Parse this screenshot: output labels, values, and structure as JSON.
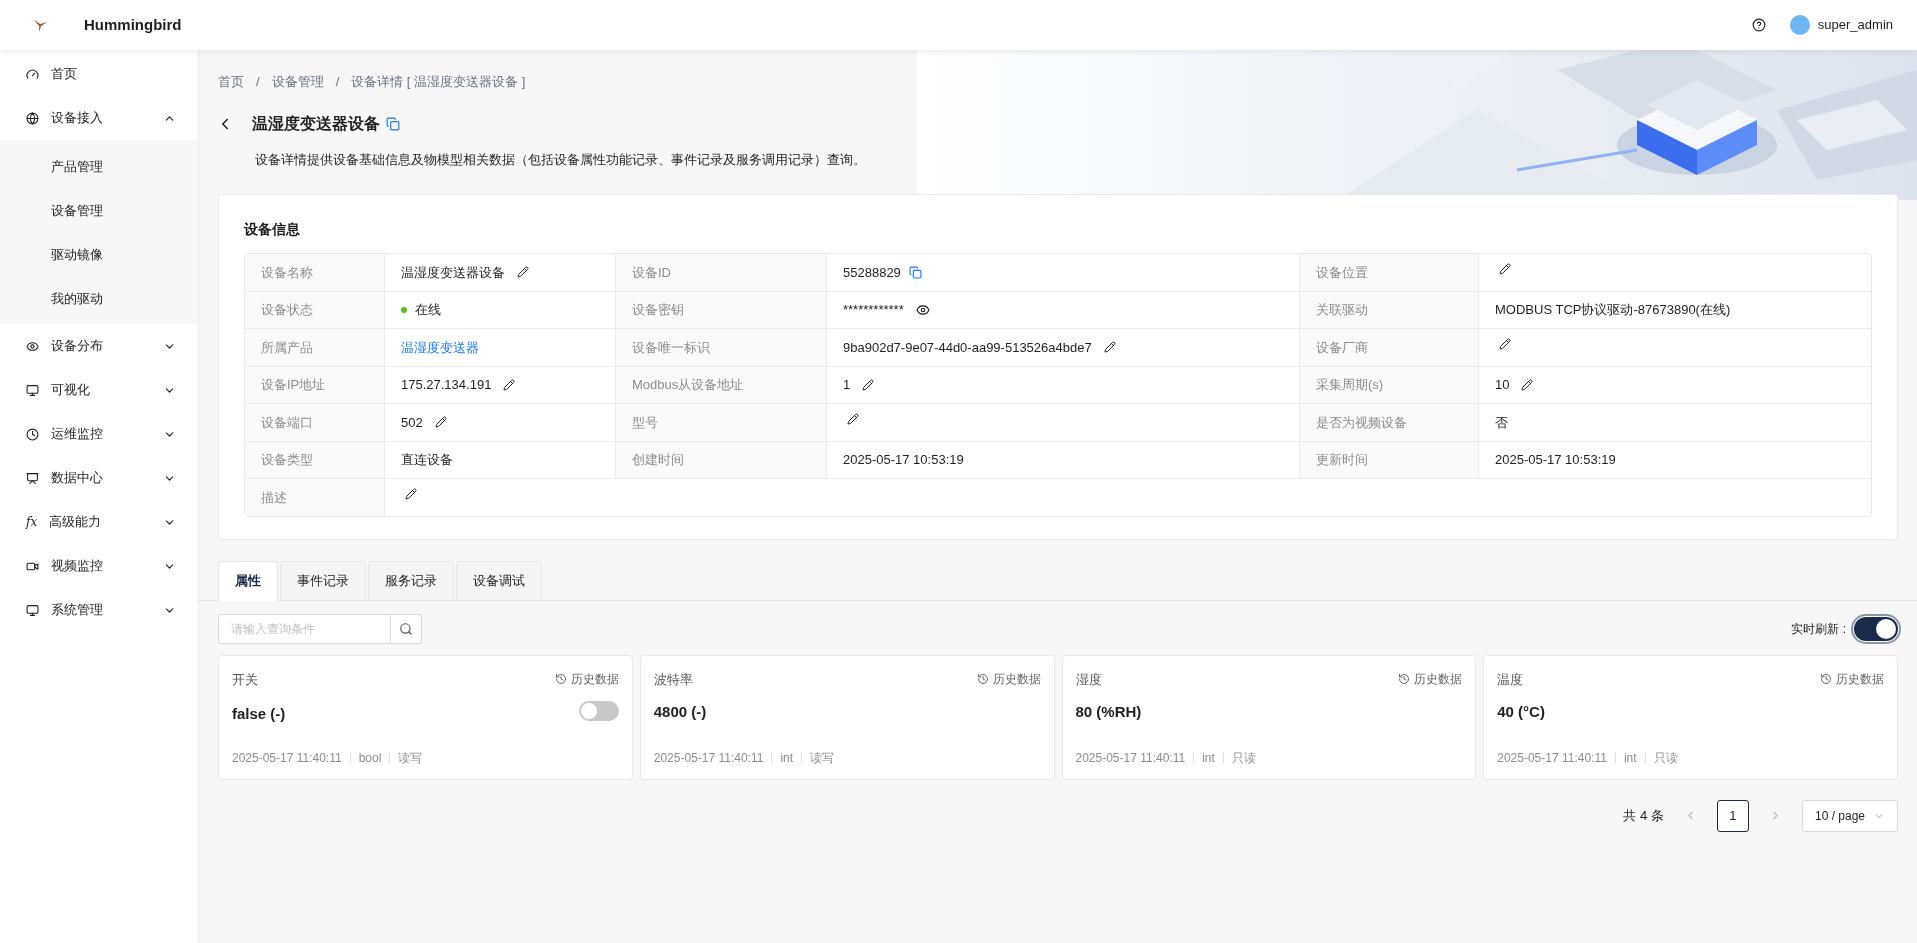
{
  "header": {
    "brand": "Hummingbird",
    "user": "super_admin"
  },
  "sidebar": {
    "items": [
      {
        "label": "首页"
      },
      {
        "label": "设备接入",
        "expanded": true,
        "children": [
          {
            "label": "产品管理"
          },
          {
            "label": "设备管理"
          },
          {
            "label": "驱动镜像"
          },
          {
            "label": "我的驱动"
          }
        ]
      },
      {
        "label": "设备分布",
        "expanded": false
      },
      {
        "label": "可视化",
        "expanded": false
      },
      {
        "label": "运维监控",
        "expanded": false
      },
      {
        "label": "数据中心",
        "expanded": false
      },
      {
        "label": "高级能力",
        "icon_text": "fx",
        "expanded": false
      },
      {
        "label": "视频监控",
        "expanded": false
      },
      {
        "label": "系统管理",
        "expanded": false
      }
    ]
  },
  "breadcrumb": [
    {
      "label": "首页"
    },
    {
      "separator": "/",
      "label": "设备管理"
    },
    {
      "separator": "/",
      "label": "设备详情 [ 温湿度变送器设备 ]"
    }
  ],
  "page": {
    "title": "温湿度变送器设备",
    "description": "设备详情提供设备基础信息及物模型相关数据（包括设备属性功能记录、事件记录及服务调用记录）查询。"
  },
  "device_info": {
    "title": "设备信息",
    "rows": [
      [
        {
          "label": "设备名称",
          "value": "温湿度变送器设备",
          "kind": "text",
          "editable": true
        },
        {
          "label": "设备ID",
          "value": "55288829",
          "kind": "copy",
          "editable": false
        },
        {
          "label": "设备位置",
          "kind": "text",
          "editable": true
        }
      ],
      [
        {
          "label": "设备状态",
          "value": "在线",
          "kind": "status",
          "color": "#52c41a",
          "editable": false
        },
        {
          "label": "设备密钥",
          "value": "************",
          "kind": "secret",
          "editable": false
        },
        {
          "label": "关联驱动",
          "value": "MODBUS TCP协议驱动-87673890(在线)",
          "kind": "text",
          "editable": false
        }
      ],
      [
        {
          "label": "所属产品",
          "value": "温湿度变送器",
          "kind": "link",
          "editable": false
        },
        {
          "label": "设备唯一标识",
          "value": "9ba902d7-9e07-44d0-aa99-513526a4bde7",
          "kind": "text",
          "editable": true
        },
        {
          "label": "设备厂商",
          "kind": "text",
          "editable": true
        }
      ],
      [
        {
          "label": "设备IP地址",
          "value": "175.27.134.191",
          "kind": "text",
          "editable": true
        },
        {
          "label": "Modbus从设备地址",
          "value": "1",
          "kind": "text",
          "editable": true
        },
        {
          "label": "采集周期(s)",
          "value": "10",
          "kind": "text",
          "editable": true
        }
      ],
      [
        {
          "label": "设备端口",
          "value": "502",
          "kind": "text",
          "editable": true
        },
        {
          "label": "型号",
          "kind": "text",
          "editable": true
        },
        {
          "label": "是否为视频设备",
          "value": "否",
          "kind": "text",
          "editable": false
        }
      ],
      [
        {
          "label": "设备类型",
          "value": "直连设备",
          "kind": "text",
          "editable": false
        },
        {
          "label": "创建时间",
          "value": "2025-05-17 10:53:19",
          "kind": "text",
          "editable": false
        },
        {
          "label": "更新时间",
          "value": "2025-05-17 10:53:19",
          "kind": "text",
          "editable": false
        }
      ],
      [
        {
          "label": "描述",
          "kind": "text",
          "editable": true
        }
      ]
    ]
  },
  "tabs": [
    {
      "label": "属性",
      "selected": true
    },
    {
      "label": "事件记录",
      "selected": false
    },
    {
      "label": "服务记录",
      "selected": false
    },
    {
      "label": "设备调试",
      "selected": false
    }
  ],
  "search": {
    "placeholder": "请输入查询条件"
  },
  "realtime_refresh": {
    "label": "实时刷新 :",
    "on": true
  },
  "properties": [
    {
      "name": "开关",
      "history": "历史数据",
      "value": "false (-)",
      "kind": "switch",
      "on": false,
      "time": "2025-05-17 11:40:11",
      "type": "bool",
      "access": "读写"
    },
    {
      "name": "波特率",
      "history": "历史数据",
      "value": "4800 (-)",
      "kind": "plain",
      "time": "2025-05-17 11:40:11",
      "type": "int",
      "access": "读写"
    },
    {
      "name": "湿度",
      "history": "历史数据",
      "value": "80 (%RH)",
      "kind": "plain",
      "time": "2025-05-17 11:40:11",
      "type": "int",
      "access": "只读"
    },
    {
      "name": "温度",
      "history": "历史数据",
      "value": "40 (°C)",
      "kind": "plain",
      "time": "2025-05-17 11:40:11",
      "type": "int",
      "access": "只读"
    }
  ],
  "pagination": {
    "total": "共 4 条",
    "pages": [
      {
        "label": "1",
        "selected": true
      }
    ],
    "page_size": "10 / page"
  }
}
